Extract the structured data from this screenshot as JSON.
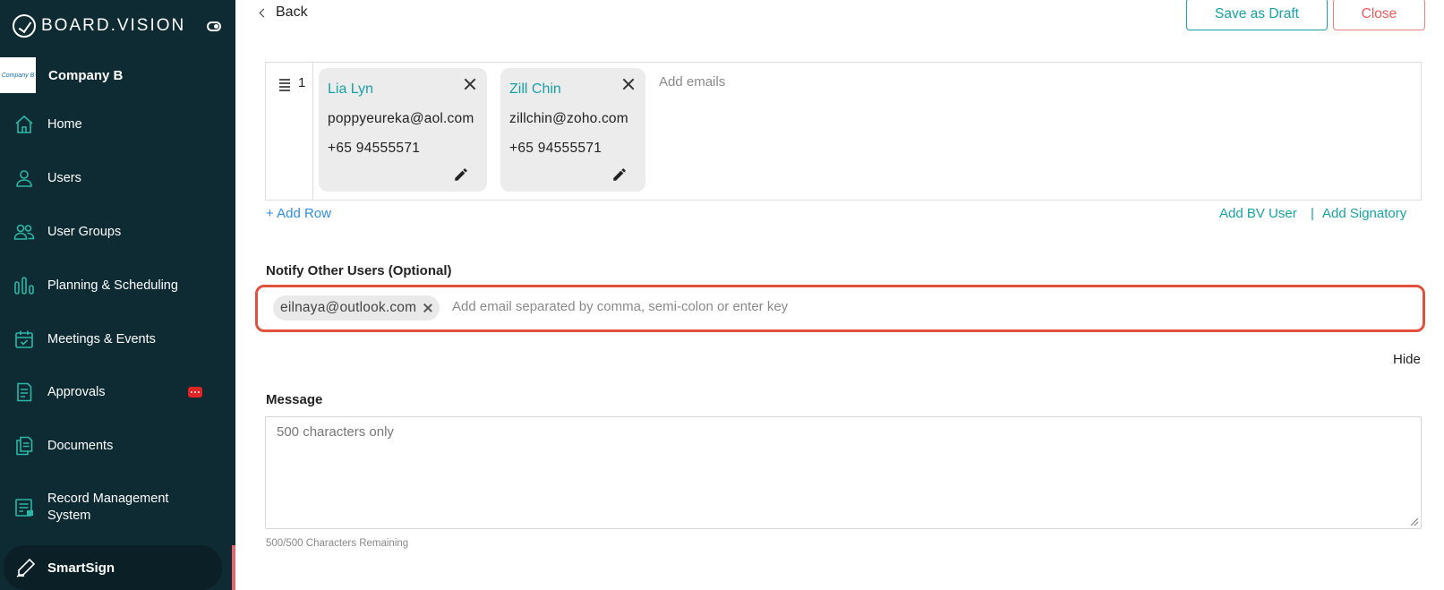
{
  "sidebar": {
    "brand": "BOARD.VISION",
    "company": {
      "logo_text": "Company B",
      "name": "Company B"
    },
    "items": [
      {
        "label": "Home",
        "icon": "home-icon"
      },
      {
        "label": "Users",
        "icon": "user-icon"
      },
      {
        "label": "User Groups",
        "icon": "user-group-icon"
      },
      {
        "label": "Planning & Scheduling",
        "icon": "bar-chart-icon"
      },
      {
        "label": "Meetings & Events",
        "icon": "calendar-icon"
      },
      {
        "label": "Approvals",
        "icon": "document-icon",
        "badge": "chat-badge"
      },
      {
        "label": "Documents",
        "icon": "documents-icon"
      },
      {
        "label": "Record Management System",
        "icon": "record-icon"
      },
      {
        "label": "SmartSign",
        "icon": "pen-icon",
        "active": true
      }
    ],
    "colors": {
      "background": "#0e2a33",
      "icon": "#2bb8a8",
      "badge": "#e02424"
    }
  },
  "header": {
    "back_label": "Back",
    "save_draft_label": "Save as Draft",
    "close_label": "Close"
  },
  "signatories": {
    "row_number": "1",
    "cards": [
      {
        "name": "Lia Lyn",
        "email": "poppyeureka@aol.com",
        "phone": "+65 94555571"
      },
      {
        "name": "Zill Chin",
        "email": "zillchin@zoho.com",
        "phone": "+65 94555571"
      }
    ],
    "add_emails_placeholder": "Add emails",
    "add_row_label": "+ Add Row",
    "add_bv_user_label": "Add BV User",
    "separator": "|",
    "add_signatory_label": "Add Signatory"
  },
  "notify": {
    "label": "Notify Other Users (Optional)",
    "chips": [
      "eilnaya@outlook.com"
    ],
    "placeholder": "Add email separated by comma, semi-colon or enter key",
    "hide_label": "Hide"
  },
  "message": {
    "label": "Message",
    "placeholder": "500 characters only",
    "counter": "500/500 Characters Remaining"
  },
  "colors": {
    "accent": "#17a2a5",
    "link": "#2f8fe0",
    "highlight": "#e0523d",
    "close": "#f05a5a"
  }
}
